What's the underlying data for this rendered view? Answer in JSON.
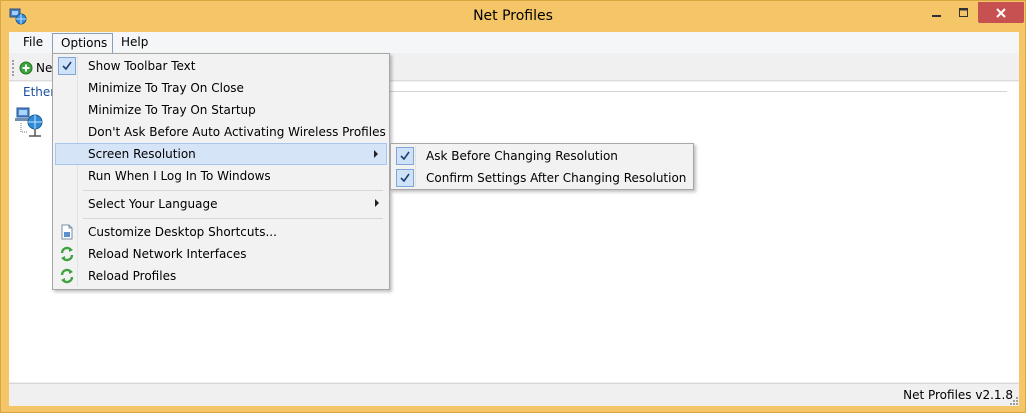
{
  "window": {
    "title": "Net Profiles"
  },
  "menubar": {
    "file": "File",
    "options": "Options",
    "help": "Help"
  },
  "toolbar": {
    "new_label": "Ne"
  },
  "content": {
    "tab_label": "Ethern"
  },
  "options_menu": {
    "items": [
      {
        "label": "Show Toolbar Text",
        "checked": true
      },
      {
        "label": "Minimize To Tray On Close"
      },
      {
        "label": "Minimize To Tray On Startup"
      },
      {
        "label": "Don't Ask Before Auto Activating Wireless Profiles"
      },
      {
        "label": "Screen Resolution",
        "submenu": true
      },
      {
        "label": "Run When I Log In To Windows"
      },
      {
        "label": "Select Your Language",
        "submenu": true
      },
      {
        "label": "Customize Desktop Shortcuts..."
      },
      {
        "label": "Reload Network Interfaces"
      },
      {
        "label": "Reload Profiles"
      }
    ]
  },
  "screen_resolution_submenu": {
    "items": [
      {
        "label": "Ask Before Changing Resolution",
        "checked": true
      },
      {
        "label": "Confirm Settings After Changing Resolution",
        "checked": true
      }
    ]
  },
  "statusbar": {
    "version": "Net Profiles v2.1.8"
  },
  "colors": {
    "frame": "#f5c668",
    "close_button": "#c75050",
    "highlight": "#d5e4f7"
  }
}
